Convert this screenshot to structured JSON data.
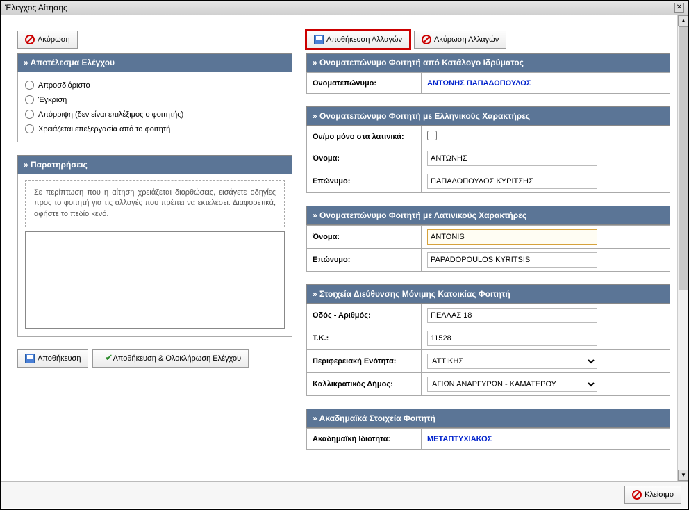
{
  "window": {
    "title": "Έλεγχος Αίτησης"
  },
  "left": {
    "cancel_btn": "Ακύρωση",
    "result_header": "» Αποτέλεσμα Ελέγχου",
    "radios": {
      "undetermined": "Απροσδιόριστο",
      "approve": "Έγκριση",
      "reject": "Απόρριψη (δεν είναι επιλέξιμος ο φοιτητής)",
      "needs_edit": "Χρειάζεται επεξεργασία από το φοιτητή"
    },
    "notes_header": "» Παρατηρήσεις",
    "notes_hint": "Σε περίπτωση που η αίτηση χρειάζεται διορθώσεις, εισάγετε οδηγίες προς το φοιτητή για τις αλλαγές που πρέπει να εκτελέσει. Διαφορετικά, αφήστε το πεδίο κενό.",
    "save_btn": "Αποθήκευση",
    "save_complete_btn": "Αποθήκευση & Ολοκλήρωση Ελέγχου"
  },
  "right": {
    "save_changes_btn": "Αποθήκευση Αλλαγών",
    "cancel_changes_btn": "Ακύρωση Αλλαγών",
    "catalog": {
      "header": "» Ονοματεπώνυμο Φοιτητή από Κατάλογο Ιδρύματος",
      "fullname_label": "Ονοματεπώνυμο:",
      "fullname_value": "ΑΝΤΩΝΗΣ ΠΑΠΑΔΟΠΟΥΛΟΣ"
    },
    "greek": {
      "header": "» Ονοματεπώνυμο Φοιτητή με Ελληνικούς Χαρακτήρες",
      "latin_only_label": "Ον/μο μόνο στα λατινικά:",
      "firstname_label": "Όνομα:",
      "firstname_value": "ΑΝΤΩΝΗΣ",
      "lastname_label": "Επώνυμο:",
      "lastname_value": "ΠΑΠΑΔΟΠΟΥΛΟΣ ΚΥΡΙΤΣΗΣ"
    },
    "latin": {
      "header": "» Ονοματεπώνυμο Φοιτητή με Λατινικούς Χαρακτήρες",
      "firstname_label": "Όνομα:",
      "firstname_value": "ANTONIS",
      "lastname_label": "Επώνυμο:",
      "lastname_value": "PAPADOPOULOS KYRITSIS"
    },
    "address": {
      "header": "» Στοιχεία Διεύθυνσης Μόνιμης Κατοικίας Φοιτητή",
      "street_label": "Οδός - Αριθμός:",
      "street_value": "ΠΕΛΛΑΣ 18",
      "zip_label": "Τ.Κ.:",
      "zip_value": "11528",
      "region_label": "Περιφερειακή Ενότητα:",
      "region_value": "ΑΤΤΙΚΗΣ",
      "muni_label": "Καλλικρατικός Δήμος:",
      "muni_value": "ΑΓΙΩΝ ΑΝΑΡΓΥΡΩΝ - ΚΑΜΑΤΕΡΟΥ"
    },
    "academic": {
      "header": "» Ακαδημαϊκά Στοιχεία Φοιτητή",
      "status_label": "Ακαδημαϊκή Ιδιότητα:",
      "status_value": "ΜΕΤΑΠΤΥΧΙΑΚΟΣ"
    }
  },
  "footer": {
    "close_btn": "Κλείσιμο"
  }
}
